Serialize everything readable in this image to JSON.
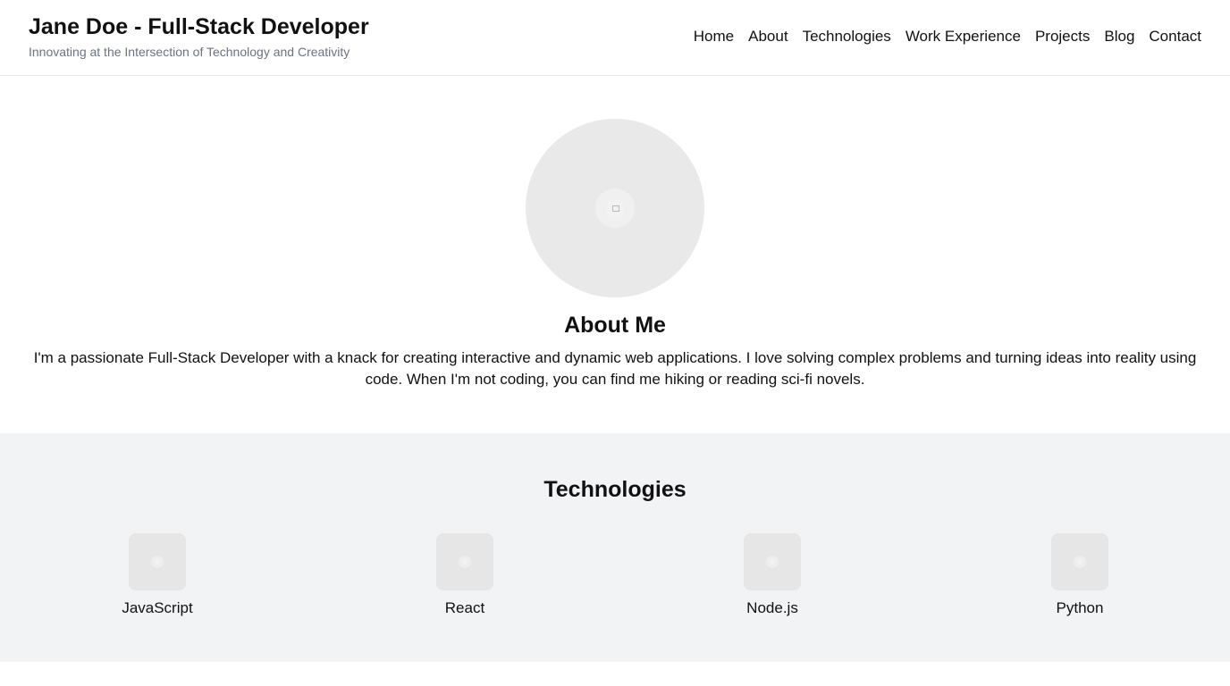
{
  "header": {
    "title": "Jane Doe - Full-Stack Developer",
    "tagline": "Innovating at the Intersection of Technology and Creativity"
  },
  "nav": {
    "items": [
      {
        "label": "Home"
      },
      {
        "label": "About"
      },
      {
        "label": "Technologies"
      },
      {
        "label": "Work Experience"
      },
      {
        "label": "Projects"
      },
      {
        "label": "Blog"
      },
      {
        "label": "Contact"
      }
    ]
  },
  "about": {
    "avatar_icon": "image-placeholder-icon",
    "heading": "About Me",
    "text": "I'm a passionate Full-Stack Developer with a knack for creating interactive and dynamic web applications. I love solving complex problems and turning ideas into reality using code. When I'm not coding, you can find me hiking or reading sci-fi novels."
  },
  "technologies": {
    "heading": "Technologies",
    "items": [
      {
        "label": "JavaScript",
        "icon": "javascript-icon"
      },
      {
        "label": "React",
        "icon": "react-icon"
      },
      {
        "label": "Node.js",
        "icon": "nodejs-icon"
      },
      {
        "label": "Python",
        "icon": "python-icon"
      }
    ]
  },
  "colors": {
    "text": "#111111",
    "muted": "#6b7280",
    "section_bg": "#f2f3f5",
    "placeholder": "#e9e9e9",
    "divider": "#e6e6e6"
  }
}
